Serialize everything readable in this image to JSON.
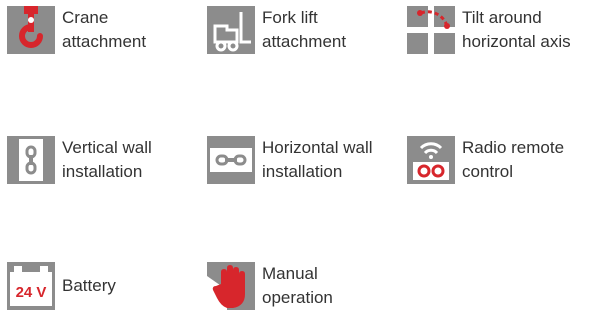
{
  "colors": {
    "icon_gray": "#8c8c8c",
    "accent_red": "#d7262c",
    "text": "#333333",
    "background": "#ffffff"
  },
  "features": [
    {
      "icon": "crane-hook-icon",
      "line1": "Crane",
      "line2": "attachment"
    },
    {
      "icon": "forklift-icon",
      "line1": "Fork lift",
      "line2": "attachment"
    },
    {
      "icon": "tilt-axis-icon",
      "line1": "Tilt around",
      "line2": "horizontal axis"
    },
    {
      "icon": "vertical-wall-icon",
      "line1": "Vertical wall",
      "line2": "installation"
    },
    {
      "icon": "horizontal-wall-icon",
      "line1": "Horizontal wall",
      "line2": "installation"
    },
    {
      "icon": "radio-remote-icon",
      "line1": "Radio remote",
      "line2": "control"
    },
    {
      "icon": "battery-icon",
      "line1": "Battery",
      "line2": "",
      "icon_text": "24 V"
    },
    {
      "icon": "manual-hand-icon",
      "line1": "Manual",
      "line2": "operation"
    }
  ]
}
